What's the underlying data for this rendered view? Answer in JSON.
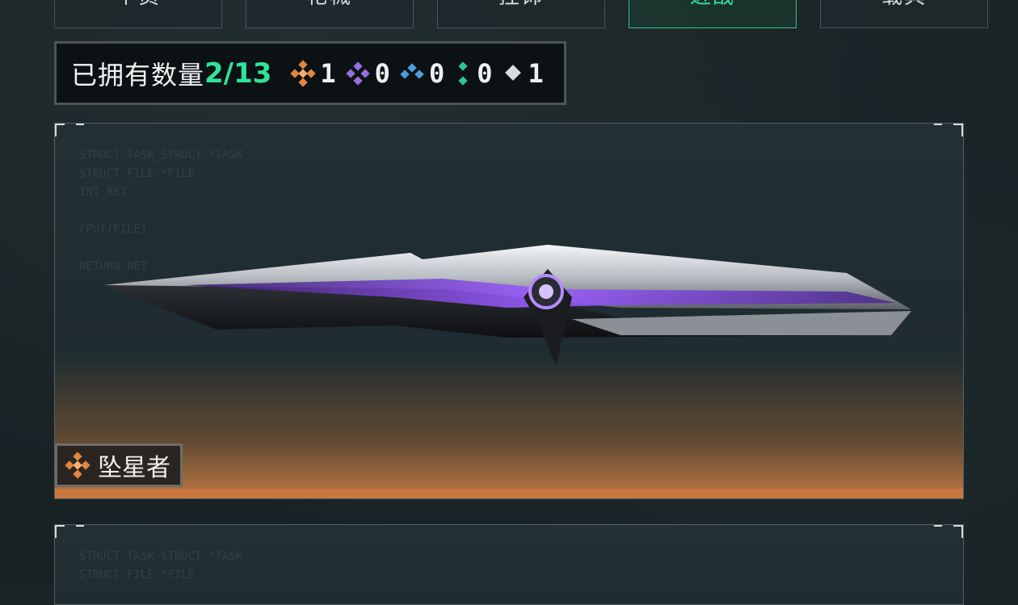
{
  "tabs": [
    {
      "label": "个员"
    },
    {
      "label": "枪械"
    },
    {
      "label": "挂饰"
    },
    {
      "label": "近战",
      "active": true
    },
    {
      "label": "载具"
    }
  ],
  "owned": {
    "label": "已拥有数量",
    "count": "2/13",
    "tiers": [
      {
        "icon": "orange-diamond-icon",
        "color": "#e0863f",
        "count": "1"
      },
      {
        "icon": "purple-diamond-icon",
        "color": "#9a6ee0",
        "count": "0"
      },
      {
        "icon": "blue-diamond-icon",
        "color": "#4a9ee0",
        "count": "0"
      },
      {
        "icon": "green-diamond-icon",
        "color": "#2ec59a",
        "count": "0"
      },
      {
        "icon": "white-diamond-icon",
        "color": "#d8dcdc",
        "count": "1"
      }
    ]
  },
  "card": {
    "name": "坠星者",
    "tier_icon": "orange-diamond-icon",
    "accent": "#c9773f"
  }
}
